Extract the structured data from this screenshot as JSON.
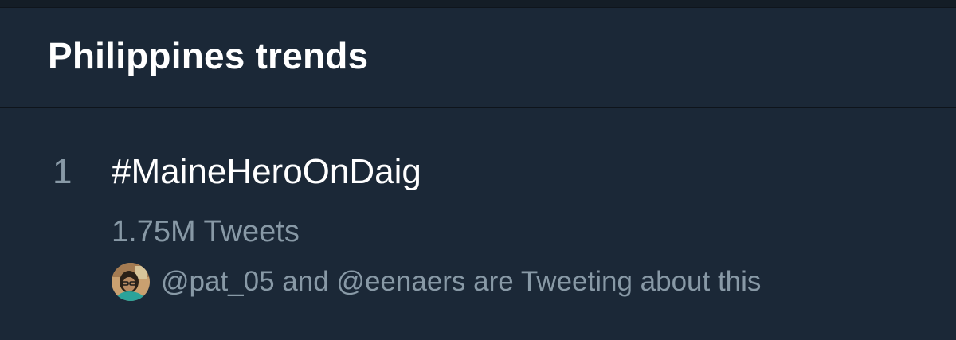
{
  "panel": {
    "title": "Philippines trends"
  },
  "trend": {
    "rank": "1",
    "name": "#MaineHeroOnDaig",
    "tweet_count": "1.75M Tweets",
    "context_text": "@pat_05 and @eenaers are Tweeting about this",
    "avatar_icon": "user-avatar"
  },
  "colors": {
    "background": "#1b2837",
    "divider": "#0e141b",
    "primary_text": "#ffffff",
    "secondary_text": "#8899a6"
  }
}
